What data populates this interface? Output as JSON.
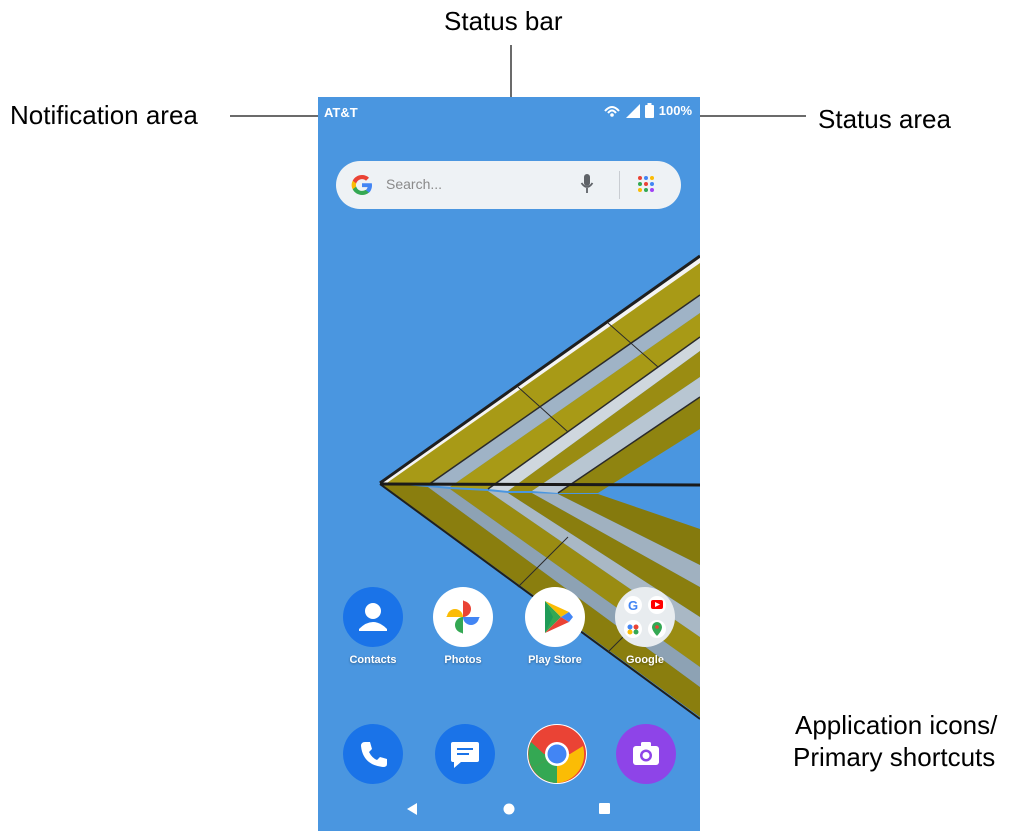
{
  "callouts": {
    "status_bar": "Status bar",
    "notification_area": "Notification area",
    "status_area": "Status area",
    "app_icons_line1": "Application icons/",
    "app_icons_line2": "Primary shortcuts"
  },
  "status_bar": {
    "carrier": "AT&T",
    "battery": "100%",
    "icons": [
      "wifi-calling-icon",
      "signal-icon",
      "battery-icon"
    ]
  },
  "search": {
    "placeholder": "Search...",
    "icons": [
      "google-icon",
      "microphone-icon",
      "app-drawer-icon"
    ]
  },
  "apps": [
    {
      "label": "Contacts",
      "icon": "contacts-icon"
    },
    {
      "label": "Photos",
      "icon": "photos-icon"
    },
    {
      "label": "Play Store",
      "icon": "play-store-icon"
    },
    {
      "label": "Google",
      "icon": "google-folder-icon"
    }
  ],
  "dock": [
    {
      "icon": "phone-icon"
    },
    {
      "icon": "messages-icon"
    },
    {
      "icon": "chrome-icon"
    },
    {
      "icon": "camera-icon"
    }
  ],
  "navbar": [
    "back-icon",
    "home-icon",
    "recents-icon"
  ],
  "colors": {
    "screen_background": "#4a96e0",
    "accent_yellow": "#a89a16",
    "search_bar": "#eef2f5"
  }
}
